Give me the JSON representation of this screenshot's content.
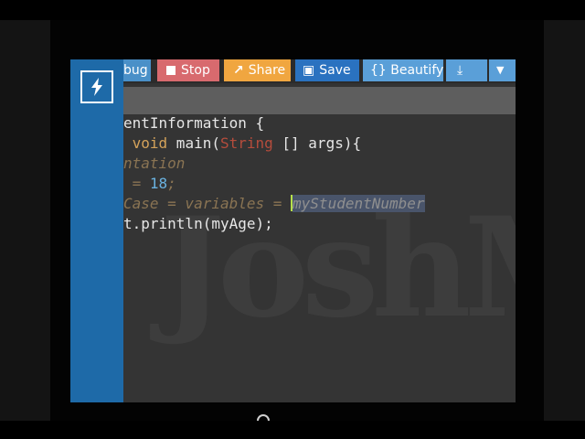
{
  "toolbar": {
    "debug_label": "bug",
    "stop_label": "Stop",
    "share_label": "Share",
    "save_label": "Save",
    "beautify_label": "{} Beautify"
  },
  "code": {
    "line1": "entInformation {",
    "line2_kw": "void",
    "line2_mid": " main(",
    "line2_str": "String",
    "line2_end": " [] args){",
    "line3": "ntation",
    "line4_pre": "= ",
    "line4_num": "18",
    "line4_end": ";",
    "line5_pre": "Case = variables = ",
    "line5_sel": "myStudentNumber",
    "line6": "t.println(myAge);"
  },
  "colors": {
    "sidebar": "#1e6aa8",
    "stop": "#d86a6e",
    "share": "#f0a640",
    "save": "#2a72c0",
    "beautify": "#5a9fd8"
  },
  "icons": [
    "bolt-icon",
    "stop-icon",
    "share-icon",
    "save-icon",
    "download-icon",
    "chevron-down-icon"
  ]
}
